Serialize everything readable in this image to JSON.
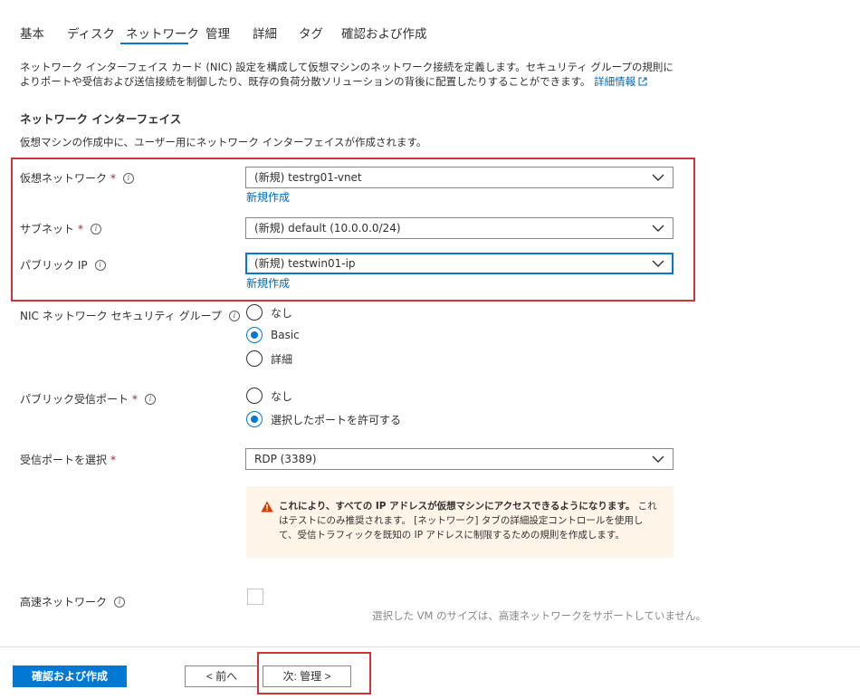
{
  "tabs": [
    {
      "label": "基本"
    },
    {
      "label": "ディスク"
    },
    {
      "label": "ネットワーク",
      "active": true
    },
    {
      "label": "管理"
    },
    {
      "label": "詳細"
    },
    {
      "label": "タグ"
    },
    {
      "label": "確認および作成"
    }
  ],
  "intro": {
    "text": "ネットワーク インターフェイス カード (NIC) 設定を構成して仮想マシンのネットワーク接続を定義します。セキュリティ グループの規則によりポートや受信および送信接続を制御したり、既存の負荷分散ソリューションの背後に配置したりすることができます。",
    "link": "詳細情報"
  },
  "network_interface": {
    "title": "ネットワーク インターフェイス",
    "subtitle": "仮想マシンの作成中に、ユーザー用にネットワーク インターフェイスが作成されます。"
  },
  "fields": {
    "vnet": {
      "label": "仮想ネットワーク",
      "value": "(新規) testrg01-vnet",
      "create_new": "新規作成"
    },
    "subnet": {
      "label": "サブネット",
      "value": "(新規) default (10.0.0.0/24)"
    },
    "public_ip": {
      "label": "パブリック IP",
      "value": "(新規) testwin01-ip",
      "create_new": "新規作成"
    },
    "nic_nsg": {
      "label": "NIC ネットワーク セキュリティ グループ",
      "options": [
        "なし",
        "Basic",
        "詳細"
      ],
      "selected": "Basic"
    },
    "public_inbound_ports": {
      "label": "パブリック受信ポート",
      "options": [
        "なし",
        "選択したポートを許可する"
      ],
      "selected": "選択したポートを許可する"
    },
    "inbound_ports": {
      "label": "受信ポートを選択",
      "value": "RDP (3389)"
    },
    "accelerated_networking": {
      "label": "高速ネットワーク",
      "checked": false,
      "hint": "選択した VM のサイズは、高速ネットワークをサポートしていません。"
    }
  },
  "required_mark": "*",
  "info_glyph": "i",
  "warning": {
    "bold": "これにより、すべての IP アドレスが仮想マシンにアクセスできるようになります。",
    "text": " これはテストにのみ推奨されます。 [ネットワーク] タブの詳細設定コントロールを使用して、受信トラフィックを既知の IP アドレスに制限するための規則を作成します。"
  },
  "footer": {
    "review_create": "確認および作成",
    "previous": "< 前へ",
    "next": "次: 管理 >"
  },
  "colors": {
    "accent": "#0078d4",
    "link": "#0067b8",
    "highlight_border": "#d13438",
    "required": "#a4262c",
    "warning_bg": "#fff4e8",
    "warning_icon": "#d83b01"
  }
}
